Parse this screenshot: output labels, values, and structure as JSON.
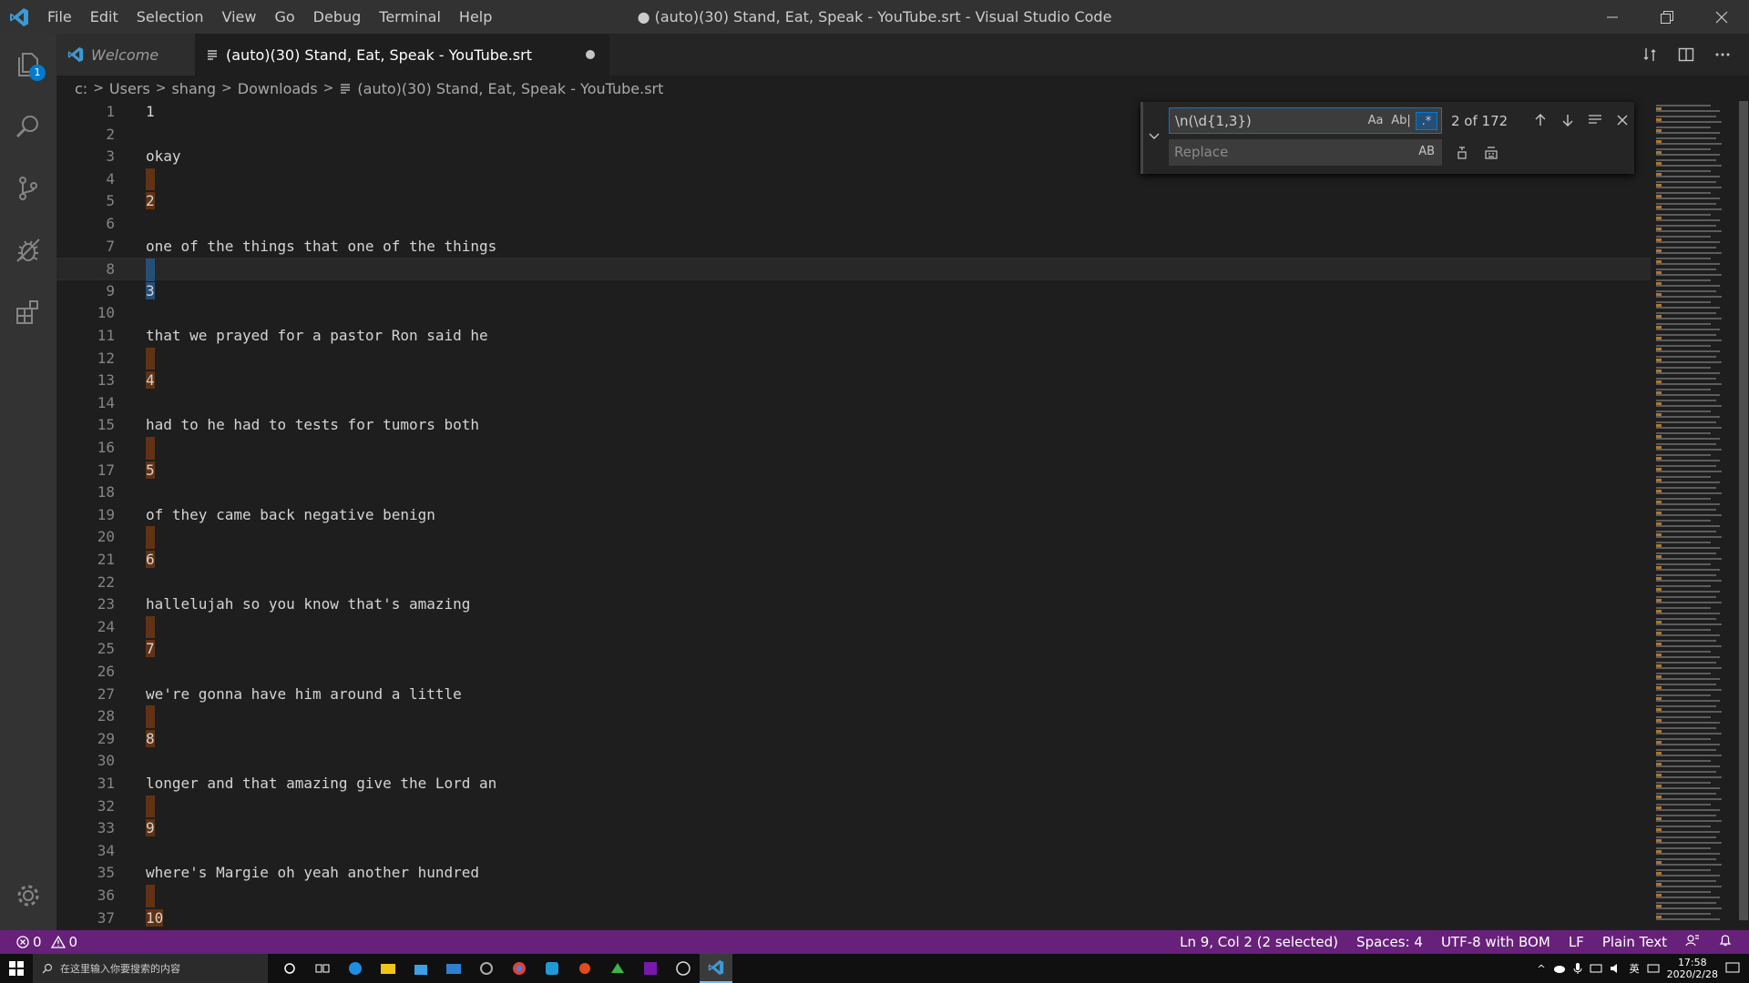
{
  "window": {
    "title": "● (auto)(30) Stand, Eat, Speak - YouTube.srt - Visual Studio Code",
    "menu": [
      "File",
      "Edit",
      "Selection",
      "View",
      "Go",
      "Debug",
      "Terminal",
      "Help"
    ]
  },
  "activity_bar": {
    "explorer_badge": "1"
  },
  "tabs": [
    {
      "label": "Welcome",
      "active": false
    },
    {
      "label": "(auto)(30) Stand, Eat, Speak - YouTube.srt",
      "active": true,
      "dirty": true
    }
  ],
  "breadcrumb": [
    "c:",
    "Users",
    "shang",
    "Downloads",
    "(auto)(30) Stand, Eat, Speak - YouTube.srt"
  ],
  "editor": {
    "lines": [
      {
        "n": "1",
        "text": "1",
        "kind": "num"
      },
      {
        "n": "2",
        "text": "",
        "kind": "blank"
      },
      {
        "n": "3",
        "text": "okay",
        "kind": "text"
      },
      {
        "n": "4",
        "text": "",
        "kind": "match"
      },
      {
        "n": "5",
        "text": "2",
        "kind": "matchnum"
      },
      {
        "n": "6",
        "text": "",
        "kind": "blank"
      },
      {
        "n": "7",
        "text": "one of the things that one of the things",
        "kind": "text"
      },
      {
        "n": "8",
        "text": "",
        "kind": "sel"
      },
      {
        "n": "9",
        "text": "3",
        "kind": "selnum"
      },
      {
        "n": "10",
        "text": "",
        "kind": "blank"
      },
      {
        "n": "11",
        "text": "that we prayed for a pastor Ron said he",
        "kind": "text"
      },
      {
        "n": "12",
        "text": "",
        "kind": "match"
      },
      {
        "n": "13",
        "text": "4",
        "kind": "matchnum"
      },
      {
        "n": "14",
        "text": "",
        "kind": "blank"
      },
      {
        "n": "15",
        "text": "had to he had to tests for tumors both",
        "kind": "text"
      },
      {
        "n": "16",
        "text": "",
        "kind": "match"
      },
      {
        "n": "17",
        "text": "5",
        "kind": "matchnum"
      },
      {
        "n": "18",
        "text": "",
        "kind": "blank"
      },
      {
        "n": "19",
        "text": "of they came back negative benign",
        "kind": "text"
      },
      {
        "n": "20",
        "text": "",
        "kind": "match"
      },
      {
        "n": "21",
        "text": "6",
        "kind": "matchnum"
      },
      {
        "n": "22",
        "text": "",
        "kind": "blank"
      },
      {
        "n": "23",
        "text": "hallelujah so you know that's amazing",
        "kind": "text"
      },
      {
        "n": "24",
        "text": "",
        "kind": "match"
      },
      {
        "n": "25",
        "text": "7",
        "kind": "matchnum"
      },
      {
        "n": "26",
        "text": "",
        "kind": "blank"
      },
      {
        "n": "27",
        "text": "we're gonna have him around a little",
        "kind": "text"
      },
      {
        "n": "28",
        "text": "",
        "kind": "match"
      },
      {
        "n": "29",
        "text": "8",
        "kind": "matchnum"
      },
      {
        "n": "30",
        "text": "",
        "kind": "blank"
      },
      {
        "n": "31",
        "text": "longer and that amazing give the Lord an",
        "kind": "text"
      },
      {
        "n": "32",
        "text": "",
        "kind": "match"
      },
      {
        "n": "33",
        "text": "9",
        "kind": "matchnum"
      },
      {
        "n": "34",
        "text": "",
        "kind": "blank"
      },
      {
        "n": "35",
        "text": "where's Margie oh yeah another hundred",
        "kind": "text"
      },
      {
        "n": "36",
        "text": "",
        "kind": "match"
      },
      {
        "n": "37",
        "text": "10",
        "kind": "matchnum"
      }
    ]
  },
  "find_widget": {
    "find_value": "\\n(\\d{1,3})",
    "match_case": "Aa",
    "whole_word": "Ab|",
    "regex": ".*",
    "count": "2 of 172",
    "replace_placeholder": "Replace",
    "preserve_case": "AB"
  },
  "status_bar": {
    "errors": "0",
    "warnings": "0",
    "position": "Ln 9, Col 2 (2 selected)",
    "indent": "Spaces: 4",
    "encoding": "UTF-8 with BOM",
    "eol": "LF",
    "language": "Plain Text"
  },
  "taskbar": {
    "search_placeholder": "在这里输入你要搜索的内容",
    "ime": "英",
    "time": "17:58",
    "date": "2020/2/28"
  },
  "colors": {
    "status_bar": "#68217a",
    "find_match": "#613214",
    "selection": "#264f78",
    "accent": "#007acc"
  }
}
